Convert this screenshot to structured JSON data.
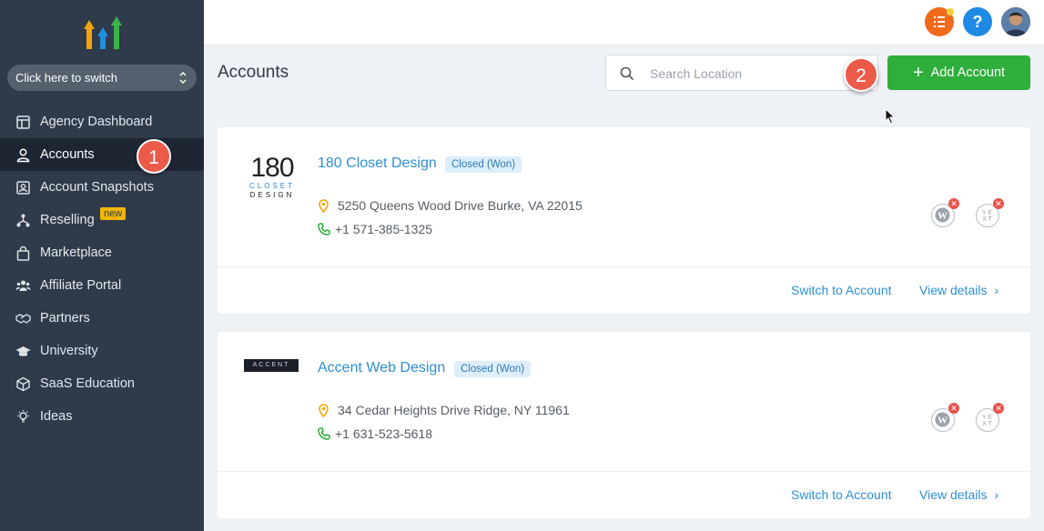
{
  "sidebar": {
    "switcher_label": "Click here to switch",
    "items": [
      {
        "label": "Agency Dashboard",
        "icon": "dashboard-icon"
      },
      {
        "label": "Accounts",
        "icon": "user-icon",
        "active": true
      },
      {
        "label": "Account Snapshots",
        "icon": "snapshot-icon"
      },
      {
        "label": "Reselling",
        "icon": "network-icon",
        "badge": "new"
      },
      {
        "label": "Marketplace",
        "icon": "bag-icon"
      },
      {
        "label": "Affiliate Portal",
        "icon": "people-icon"
      },
      {
        "label": "Partners",
        "icon": "handshake-icon"
      },
      {
        "label": "University",
        "icon": "graduation-cap-icon"
      },
      {
        "label": "SaaS Education",
        "icon": "box-icon"
      },
      {
        "label": "Ideas",
        "icon": "lightbulb-icon"
      }
    ]
  },
  "annotations": {
    "step1": "1",
    "step2": "2"
  },
  "topbar": {
    "icons": [
      "tasks-icon",
      "help-icon",
      "avatar"
    ],
    "help_label": "?"
  },
  "header": {
    "title": "Accounts",
    "search_placeholder": "Search Location",
    "add_button_label": "Add Account"
  },
  "accounts": [
    {
      "name": "180 Closet Design",
      "status": "Closed (Won)",
      "address": "5250 Queens Wood Drive Burke, VA 22015",
      "phone": "+1 571-385-1325",
      "logo_text": "180",
      "logo_sub1": "CLOSET",
      "logo_sub2": "DESIGN",
      "switch_label": "Switch to Account",
      "details_label": "View details"
    },
    {
      "name": "Accent Web Design",
      "status": "Closed (Won)",
      "address": "34 Cedar Heights Drive Ridge, NY 11961",
      "phone": "+1 631-523-5618",
      "logo_text": "ACCENT",
      "switch_label": "Switch to Account",
      "details_label": "View details"
    }
  ],
  "colors": {
    "sidebar_bg": "#2f3a4b",
    "accent_green": "#2eae3a",
    "link_blue": "#2d8fd5",
    "step_red": "#ec5a4a"
  }
}
